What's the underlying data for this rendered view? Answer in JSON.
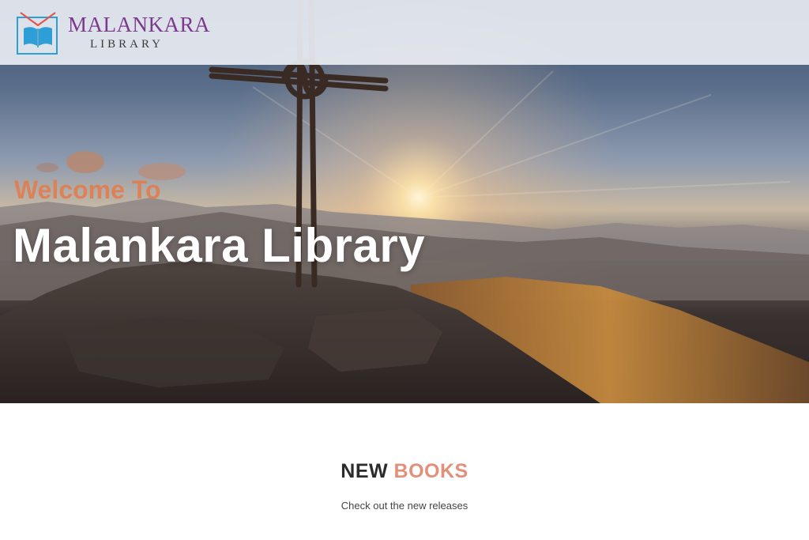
{
  "header": {
    "logo": {
      "line1": "MALANKARA",
      "line2": "LIBRARY",
      "icon": "open-book-icon"
    }
  },
  "hero": {
    "welcome": "Welcome To",
    "title": "Malankara Library",
    "image": "mountain-sunrise-with-cross"
  },
  "new_books": {
    "title_part1": "NEW",
    "title_part2": "BOOKS",
    "subtitle": "Check out the new releases"
  },
  "colors": {
    "accent_orange": "#e07e52",
    "accent_pink": "#e3907a",
    "logo_purple": "#7b3a8c",
    "logo_blue": "#2b9fd6",
    "logo_red": "#e2564f"
  }
}
